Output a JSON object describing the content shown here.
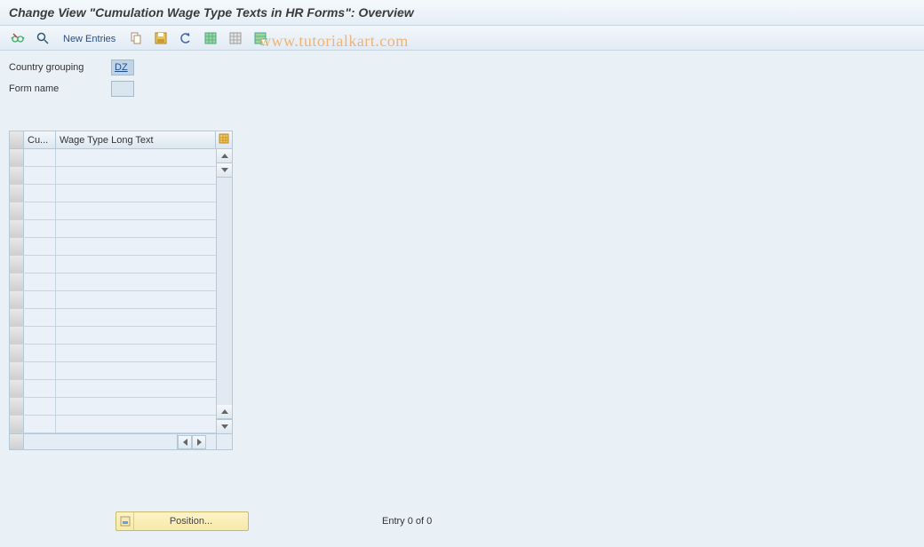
{
  "title": "Change View \"Cumulation Wage Type Texts in HR Forms\": Overview",
  "watermark": "www.tutorialkart.com",
  "toolbar": {
    "new_entries_label": "New Entries"
  },
  "form": {
    "country_grouping_label": "Country grouping",
    "country_grouping_value": "DZ",
    "form_name_label": "Form name",
    "form_name_value": ""
  },
  "table": {
    "columns": {
      "cu": "Cu...",
      "wage_type_long_text": "Wage Type Long Text"
    },
    "row_count": 16
  },
  "footer": {
    "position_label": "Position...",
    "entry_status": "Entry 0 of 0"
  }
}
